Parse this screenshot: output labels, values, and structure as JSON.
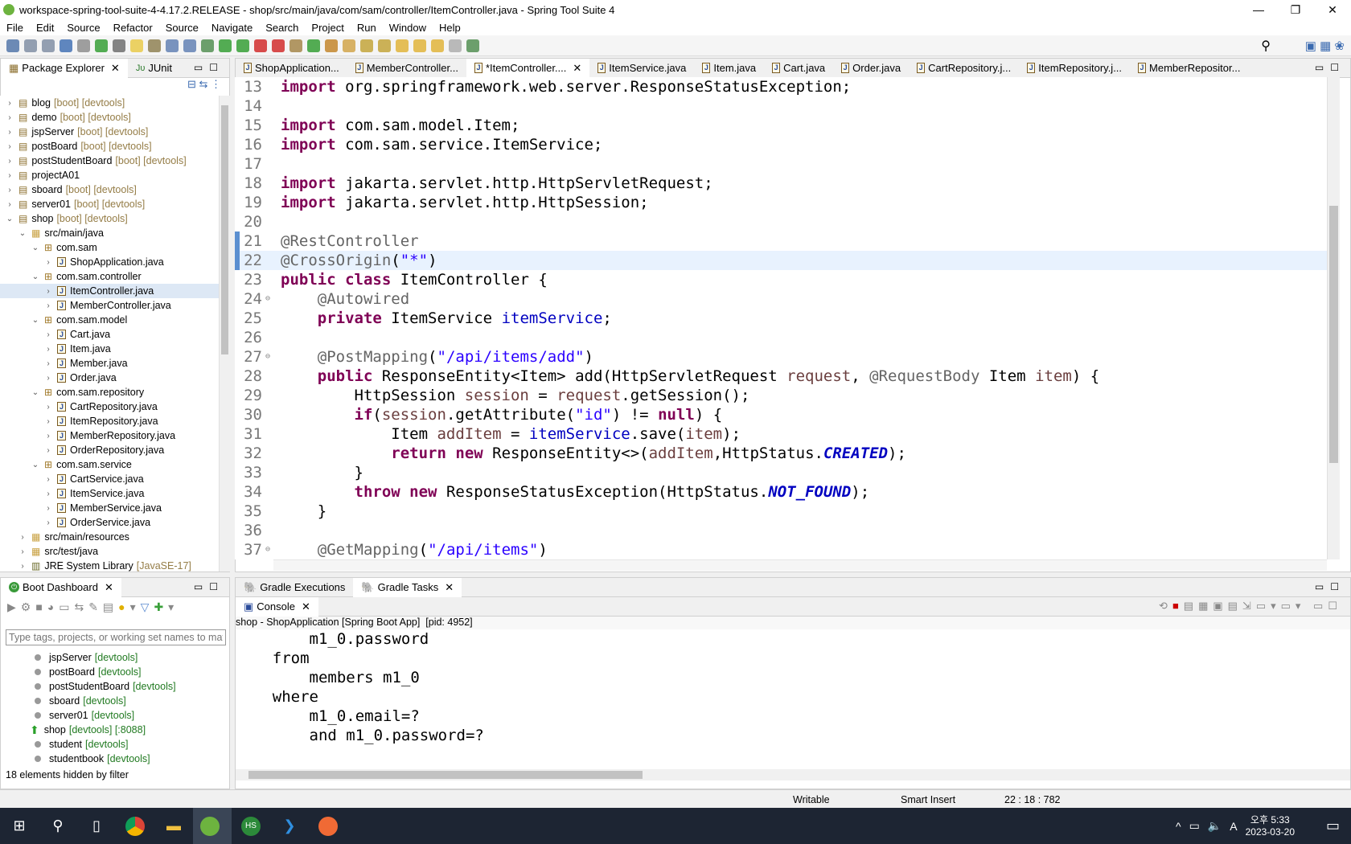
{
  "window": {
    "title": "workspace-spring-tool-suite-4-4.17.2.RELEASE - shop/src/main/java/com/sam/controller/ItemController.java - Spring Tool Suite 4",
    "controls": [
      "—",
      "❐",
      "✕"
    ]
  },
  "menu": [
    "File",
    "Edit",
    "Source",
    "Refactor",
    "Source",
    "Navigate",
    "Search",
    "Project",
    "Run",
    "Window",
    "Help"
  ],
  "left_tabs": [
    {
      "label": "Package Explorer",
      "active": true
    },
    {
      "label": "JUnit",
      "active": false
    }
  ],
  "tree": [
    {
      "depth": 0,
      "arrow": "›",
      "label": "blog",
      "dec": "[boot] [devtools]",
      "icon": "project"
    },
    {
      "depth": 0,
      "arrow": "›",
      "label": "demo",
      "dec": "[boot] [devtools]",
      "icon": "project"
    },
    {
      "depth": 0,
      "arrow": "›",
      "label": "jspServer",
      "dec": "[boot] [devtools]",
      "icon": "project"
    },
    {
      "depth": 0,
      "arrow": "›",
      "label": "postBoard",
      "dec": "[boot] [devtools]",
      "icon": "project"
    },
    {
      "depth": 0,
      "arrow": "›",
      "label": "postStudentBoard",
      "dec": "[boot] [devtools]",
      "icon": "project"
    },
    {
      "depth": 0,
      "arrow": "›",
      "label": "projectA01",
      "dec": "",
      "icon": "project"
    },
    {
      "depth": 0,
      "arrow": "›",
      "label": "sboard",
      "dec": "[boot] [devtools]",
      "icon": "project"
    },
    {
      "depth": 0,
      "arrow": "›",
      "label": "server01",
      "dec": "[boot] [devtools]",
      "icon": "project"
    },
    {
      "depth": 0,
      "arrow": "⌄",
      "label": "shop",
      "dec": "[boot] [devtools]",
      "icon": "project"
    },
    {
      "depth": 1,
      "arrow": "⌄",
      "label": "src/main/java",
      "dec": "",
      "icon": "folder"
    },
    {
      "depth": 2,
      "arrow": "⌄",
      "label": "com.sam",
      "dec": "",
      "icon": "package"
    },
    {
      "depth": 3,
      "arrow": "›",
      "label": "ShopApplication.java",
      "dec": "",
      "icon": "java"
    },
    {
      "depth": 2,
      "arrow": "⌄",
      "label": "com.sam.controller",
      "dec": "",
      "icon": "package"
    },
    {
      "depth": 3,
      "arrow": "›",
      "label": "ItemController.java",
      "dec": "",
      "icon": "java",
      "selected": true
    },
    {
      "depth": 3,
      "arrow": "›",
      "label": "MemberController.java",
      "dec": "",
      "icon": "java"
    },
    {
      "depth": 2,
      "arrow": "⌄",
      "label": "com.sam.model",
      "dec": "",
      "icon": "package"
    },
    {
      "depth": 3,
      "arrow": "›",
      "label": "Cart.java",
      "dec": "",
      "icon": "java"
    },
    {
      "depth": 3,
      "arrow": "›",
      "label": "Item.java",
      "dec": "",
      "icon": "java"
    },
    {
      "depth": 3,
      "arrow": "›",
      "label": "Member.java",
      "dec": "",
      "icon": "java"
    },
    {
      "depth": 3,
      "arrow": "›",
      "label": "Order.java",
      "dec": "",
      "icon": "java"
    },
    {
      "depth": 2,
      "arrow": "⌄",
      "label": "com.sam.repository",
      "dec": "",
      "icon": "package"
    },
    {
      "depth": 3,
      "arrow": "›",
      "label": "CartRepository.java",
      "dec": "",
      "icon": "java"
    },
    {
      "depth": 3,
      "arrow": "›",
      "label": "ItemRepository.java",
      "dec": "",
      "icon": "java"
    },
    {
      "depth": 3,
      "arrow": "›",
      "label": "MemberRepository.java",
      "dec": "",
      "icon": "java"
    },
    {
      "depth": 3,
      "arrow": "›",
      "label": "OrderRepository.java",
      "dec": "",
      "icon": "java"
    },
    {
      "depth": 2,
      "arrow": "⌄",
      "label": "com.sam.service",
      "dec": "",
      "icon": "package"
    },
    {
      "depth": 3,
      "arrow": "›",
      "label": "CartService.java",
      "dec": "",
      "icon": "java"
    },
    {
      "depth": 3,
      "arrow": "›",
      "label": "ItemService.java",
      "dec": "",
      "icon": "java"
    },
    {
      "depth": 3,
      "arrow": "›",
      "label": "MemberService.java",
      "dec": "",
      "icon": "java"
    },
    {
      "depth": 3,
      "arrow": "›",
      "label": "OrderService.java",
      "dec": "",
      "icon": "java"
    },
    {
      "depth": 1,
      "arrow": "›",
      "label": "src/main/resources",
      "dec": "",
      "icon": "folder"
    },
    {
      "depth": 1,
      "arrow": "›",
      "label": "src/test/java",
      "dec": "",
      "icon": "folder"
    },
    {
      "depth": 1,
      "arrow": "›",
      "label": "JRE System Library",
      "dec": "[JavaSE-17]",
      "icon": "library"
    }
  ],
  "editor_tabs": [
    {
      "label": "ShopApplication...",
      "active": false
    },
    {
      "label": "MemberController...",
      "active": false
    },
    {
      "label": "*ItemController....",
      "active": true
    },
    {
      "label": "ItemService.java",
      "active": false
    },
    {
      "label": "Item.java",
      "active": false
    },
    {
      "label": "Cart.java",
      "active": false
    },
    {
      "label": "Order.java",
      "active": false
    },
    {
      "label": "CartRepository.j...",
      "active": false
    },
    {
      "label": "ItemRepository.j...",
      "active": false
    },
    {
      "label": "MemberRepositor...",
      "active": false
    }
  ],
  "code": [
    {
      "n": "13",
      "t": [
        [
          "import",
          "kw"
        ],
        [
          " org.springframework.web.server.ResponseStatusException;",
          ""
        ]
      ]
    },
    {
      "n": "14",
      "t": []
    },
    {
      "n": "15",
      "t": [
        [
          "import",
          "kw"
        ],
        [
          " com.sam.model.Item;",
          ""
        ]
      ]
    },
    {
      "n": "16",
      "t": [
        [
          "import",
          "kw"
        ],
        [
          " com.sam.service.ItemService;",
          ""
        ]
      ]
    },
    {
      "n": "17",
      "t": []
    },
    {
      "n": "18",
      "t": [
        [
          "import",
          "kw"
        ],
        [
          " jakarta.servlet.http.HttpServletRequest;",
          ""
        ]
      ]
    },
    {
      "n": "19",
      "t": [
        [
          "import",
          "kw"
        ],
        [
          " jakarta.servlet.http.HttpSession;",
          ""
        ]
      ]
    },
    {
      "n": "20",
      "t": []
    },
    {
      "n": "21",
      "t": [
        [
          "@RestController",
          "an"
        ]
      ]
    },
    {
      "n": "22",
      "t": [
        [
          "@CrossOrigin",
          "an"
        ],
        [
          "(",
          ""
        ],
        [
          "\"*\"",
          "st"
        ],
        [
          ")",
          ""
        ]
      ],
      "current": true
    },
    {
      "n": "23",
      "t": [
        [
          "public",
          "kw"
        ],
        [
          " ",
          ""
        ],
        [
          "class",
          "kw"
        ],
        [
          " ItemController {",
          ""
        ]
      ]
    },
    {
      "n": "24",
      "t": [
        [
          "    ",
          ""
        ],
        [
          "@Autowired",
          "an"
        ]
      ],
      "fold": true
    },
    {
      "n": "25",
      "t": [
        [
          "    ",
          ""
        ],
        [
          "private",
          "kw"
        ],
        [
          " ItemService ",
          ""
        ],
        [
          "itemService",
          "fd"
        ],
        [
          ";",
          ""
        ]
      ]
    },
    {
      "n": "26",
      "t": []
    },
    {
      "n": "27",
      "t": [
        [
          "    ",
          ""
        ],
        [
          "@PostMapping",
          "an"
        ],
        [
          "(",
          ""
        ],
        [
          "\"/api/items/add\"",
          "st"
        ],
        [
          ")",
          ""
        ]
      ],
      "fold": true
    },
    {
      "n": "28",
      "t": [
        [
          "    ",
          ""
        ],
        [
          "public",
          "kw"
        ],
        [
          " ResponseEntity<Item> add(HttpServletRequest ",
          ""
        ],
        [
          "request",
          "lv"
        ],
        [
          ", ",
          ""
        ],
        [
          "@RequestBody",
          "an"
        ],
        [
          " Item ",
          ""
        ],
        [
          "item",
          "lv"
        ],
        [
          ") {",
          ""
        ]
      ]
    },
    {
      "n": "29",
      "t": [
        [
          "        HttpSession ",
          ""
        ],
        [
          "session",
          "lv"
        ],
        [
          " = ",
          ""
        ],
        [
          "request",
          "lv"
        ],
        [
          ".getSession();",
          ""
        ]
      ]
    },
    {
      "n": "30",
      "t": [
        [
          "        ",
          ""
        ],
        [
          "if",
          "kw"
        ],
        [
          "(",
          ""
        ],
        [
          "session",
          "lv"
        ],
        [
          ".getAttribute(",
          ""
        ],
        [
          "\"id\"",
          "st"
        ],
        [
          ") != ",
          ""
        ],
        [
          "null",
          "kw"
        ],
        [
          ") {",
          ""
        ]
      ]
    },
    {
      "n": "31",
      "t": [
        [
          "            Item ",
          ""
        ],
        [
          "addItem",
          "lv"
        ],
        [
          " = ",
          ""
        ],
        [
          "itemService",
          "fd"
        ],
        [
          ".save(",
          ""
        ],
        [
          "item",
          "lv"
        ],
        [
          ");",
          ""
        ]
      ]
    },
    {
      "n": "32",
      "t": [
        [
          "            ",
          ""
        ],
        [
          "return",
          "kw"
        ],
        [
          " ",
          ""
        ],
        [
          "new",
          "kw"
        ],
        [
          " ResponseEntity<>(",
          ""
        ],
        [
          "addItem",
          "lv"
        ],
        [
          ",HttpStatus.",
          ""
        ],
        [
          "CREATED",
          "sf"
        ],
        [
          ");",
          ""
        ]
      ]
    },
    {
      "n": "33",
      "t": [
        [
          "        }",
          ""
        ]
      ]
    },
    {
      "n": "34",
      "t": [
        [
          "        ",
          ""
        ],
        [
          "throw",
          "kw"
        ],
        [
          " ",
          ""
        ],
        [
          "new",
          "kw"
        ],
        [
          " ResponseStatusException(HttpStatus.",
          ""
        ],
        [
          "NOT_FOUND",
          "sf"
        ],
        [
          ");",
          ""
        ]
      ]
    },
    {
      "n": "35",
      "t": [
        [
          "    }",
          ""
        ]
      ]
    },
    {
      "n": "36",
      "t": []
    },
    {
      "n": "37",
      "t": [
        [
          "    ",
          ""
        ],
        [
          "@GetMapping",
          "an"
        ],
        [
          "(",
          ""
        ],
        [
          "\"/api/items\"",
          "st"
        ],
        [
          ")",
          ""
        ]
      ],
      "fold": true
    }
  ],
  "boot_dashboard": {
    "tab": "Boot Dashboard",
    "filter_placeholder": "Type tags, projects, or working set names to match",
    "items": [
      {
        "name": "jspServer",
        "tags": "[devtools]",
        "running": false
      },
      {
        "name": "postBoard",
        "tags": "[devtools]",
        "running": false
      },
      {
        "name": "postStudentBoard",
        "tags": "[devtools]",
        "running": false
      },
      {
        "name": "sboard",
        "tags": "[devtools]",
        "running": false
      },
      {
        "name": "server01",
        "tags": "[devtools]",
        "running": false
      },
      {
        "name": "shop",
        "tags": "[devtools] [:8088]",
        "running": true
      },
      {
        "name": "student",
        "tags": "[devtools]",
        "running": false
      },
      {
        "name": "studentbook",
        "tags": "[devtools]",
        "running": false
      }
    ],
    "footer": "18 elements hidden by filter"
  },
  "gradle_tabs": [
    "Gradle Executions",
    "Gradle Tasks"
  ],
  "console": {
    "tab": "Console",
    "header": "shop - ShopApplication [Spring Boot App]  [pid: 4952]",
    "lines": [
      "        m1_0.password",
      "    from",
      "        members m1_0",
      "    where",
      "        m1_0.email=?",
      "        and m1_0.password=?"
    ]
  },
  "status": {
    "writable": "Writable",
    "insert": "Smart Insert",
    "position": "22 : 18 : 782"
  },
  "taskbar": {
    "time": "오후 5:33",
    "date": "2023-03-20",
    "ime": "A"
  }
}
